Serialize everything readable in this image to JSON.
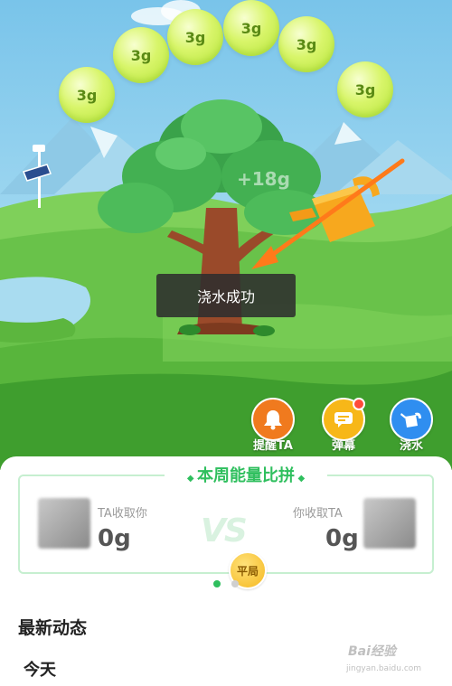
{
  "energy_bubbles": [
    "3g",
    "3g",
    "3g",
    "3g",
    "3g",
    "3g"
  ],
  "floating_energy": "+18g",
  "toast": "浇水成功",
  "actions": [
    {
      "label": "提醒TA",
      "icon": "bell-icon",
      "color": "#f07a1e"
    },
    {
      "label": "弹幕",
      "icon": "danmaku-icon",
      "color": "#f7b718",
      "badge": true
    },
    {
      "label": "浇水",
      "icon": "watering-can-icon",
      "color": "#2f8ef0"
    }
  ],
  "weekly_card": {
    "title": "本周能量比拼",
    "left_caption": "TA收取你",
    "left_value": "0g",
    "right_caption": "你收取TA",
    "right_value": "0g",
    "vs": "VS",
    "result": "平局"
  },
  "pager": {
    "count": 2,
    "active": 0
  },
  "section_title": "最新动态",
  "day_label": "今天",
  "watermark": {
    "line1": "Bai经验",
    "line2": "jingyan.baidu.com"
  },
  "colors": {
    "accent": "#2fbf5e",
    "sky": "#9fd6ee",
    "grass": "#5cc04a"
  }
}
